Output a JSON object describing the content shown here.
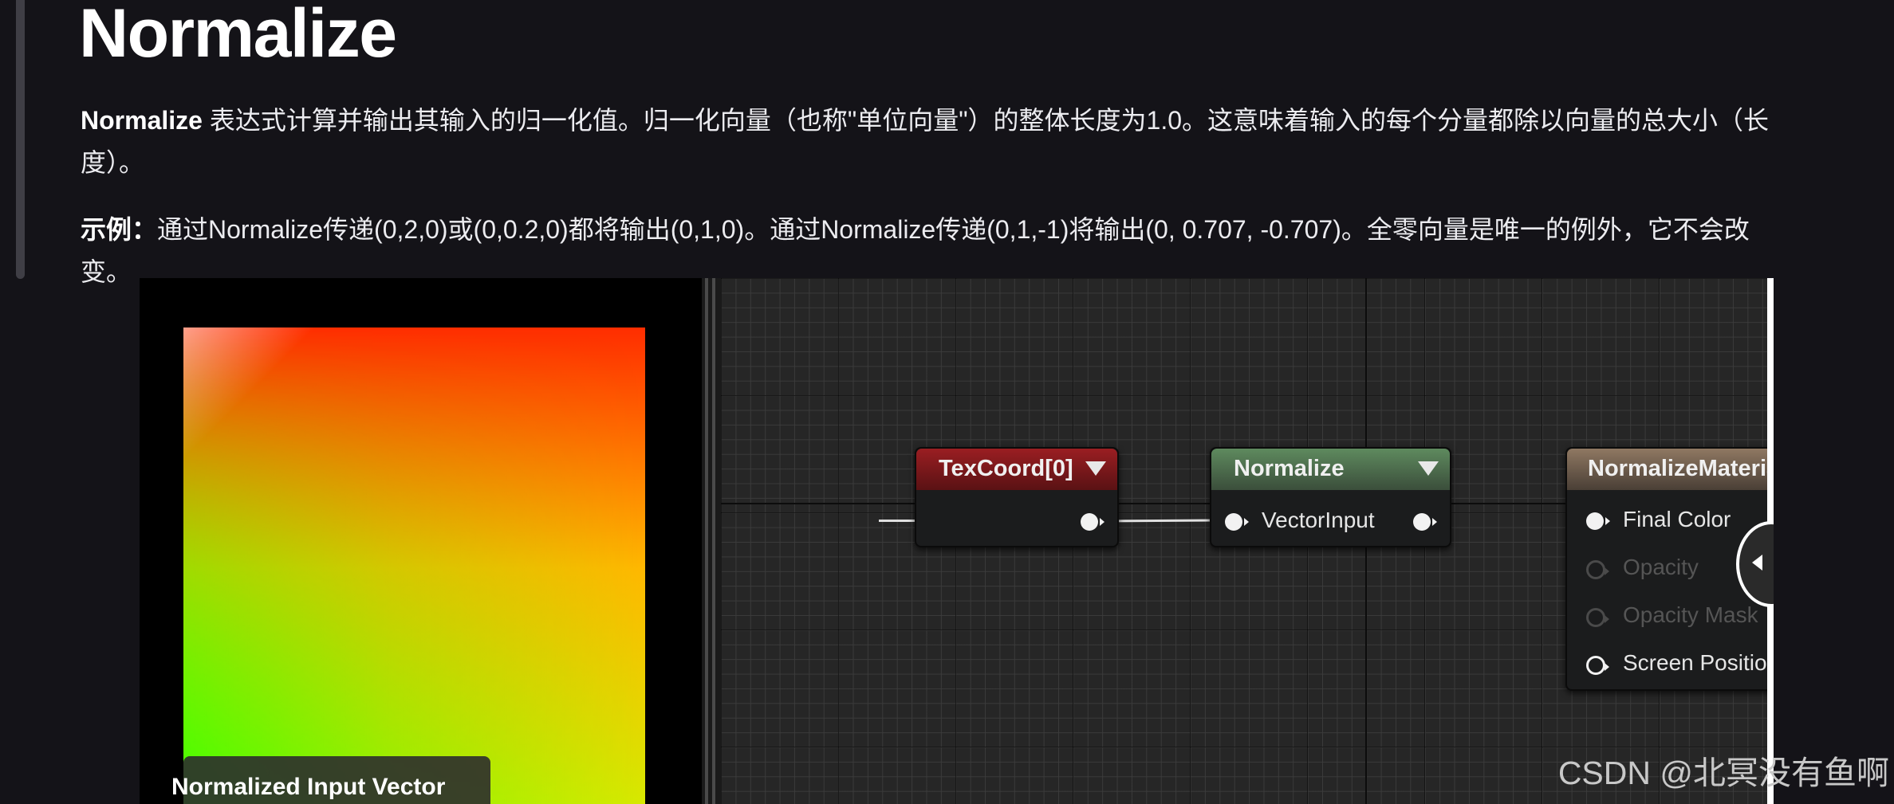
{
  "page": {
    "heading": "Normalize",
    "intro_strong": "Normalize",
    "intro_text": " 表达式计算并输出其输入的归一化值。归一化向量（也称\"单位向量\"）的整体长度为1.0。这意味着输入的每个分量都除以向量的总大小（长度）。",
    "example_label": "示例：",
    "example_text": "通过Normalize传递(0,2,0)或(0,0.2,0)都将输出(0,1,0)。通过Normalize传递(0,1,-1)将输出(0, 0.707, -0.707)。全零向量是唯一的例外，它不会改变。"
  },
  "figure": {
    "preview_caption": "Normalized Input Vector",
    "nodes": {
      "texcoord": {
        "title": "TexCoord[0]"
      },
      "normalize": {
        "title": "Normalize",
        "input_label": "VectorInput"
      },
      "material": {
        "title": "NormalizeMaterial",
        "pins": [
          "Final Color",
          "Opacity",
          "Opacity Mask",
          "Screen Position"
        ]
      }
    }
  },
  "watermark": "CSDN @北冥没有鱼啊",
  "colors": {
    "background": "#141318",
    "texcoord_header": "#9a1e22",
    "normalize_header": "#5e8a5e",
    "material_header": "#8f7862"
  },
  "icons": [
    "dropdown-arrow-icon",
    "pin-icon",
    "collapse-arrow-icon"
  ]
}
